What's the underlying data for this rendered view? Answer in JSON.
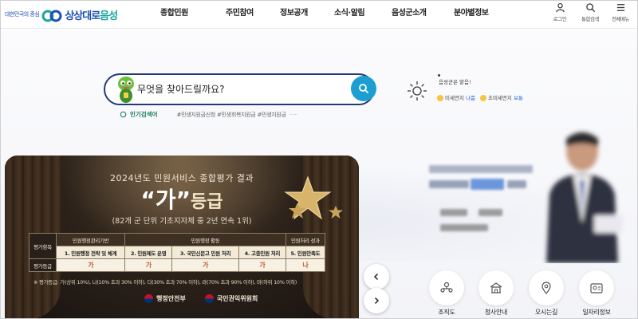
{
  "logo": {
    "tagline": "대한민국의 중심",
    "slogan": "상상대로",
    "city": "음성"
  },
  "nav": {
    "items": [
      {
        "label": "종합민원"
      },
      {
        "label": "주민참여"
      },
      {
        "label": "정보공개"
      },
      {
        "label": "소식·알림"
      },
      {
        "label": "음성군소개"
      },
      {
        "label": "분야별정보"
      }
    ]
  },
  "util": {
    "login": "로그인",
    "search": "통합검색",
    "menu": "전체메뉴"
  },
  "search": {
    "placeholder": "무엇을 찾아드릴까요?",
    "popular_label": "인기검색어",
    "popular_tags": "#민생지원금신청 #민생회복지원금 #민생지원금",
    "more": "·····"
  },
  "weather": {
    "location": "음성군은 맑음!",
    "fine_dust_label": "미세먼지",
    "fine_dust_status": "나쁨",
    "ultra_dust_label": "초미세먼지",
    "ultra_dust_status": "보통",
    "sun_color": "#3a3a3a"
  },
  "banner": {
    "title": "2024년도 민원서비스 종합평가 결과",
    "grade_open": "“",
    "grade_value": "가",
    "grade_close": "”",
    "grade_suffix": "등급",
    "subtitle": "(82개 군 단위 기초지자체 중 2년 연속 1위)",
    "table": {
      "row_label_items": "평가항목",
      "row_label_grade": "평가등급",
      "group1": "민원행정관리기반",
      "group2": "민원행정 활동",
      "group3": "민원처리 성과",
      "items": [
        "1. 민원행정 전략 및 체계",
        "2. 민원제도 운영",
        "3. 국민신문고 민원 처리",
        "4. 고충민원 처리",
        "5. 민원만족도"
      ],
      "grades": [
        "가",
        "가",
        "가",
        "가",
        "나"
      ]
    },
    "note": "※ 평가등급: 가(상위 10%), 나(10% 초과 30% 이하), 다(30% 초과 70% 이하), 라(70% 초과 90% 이하), 마(하위 10% 이하)",
    "org1": "행정안전부",
    "org2": "국민권익위원회"
  },
  "quick_links": [
    {
      "label": "조직도",
      "icon": "org-chart-icon"
    },
    {
      "label": "청사안내",
      "icon": "building-icon"
    },
    {
      "label": "오시는길",
      "icon": "location-pin-icon"
    },
    {
      "label": "일자리정보",
      "icon": "job-info-icon"
    }
  ],
  "colors": {
    "brand_blue": "#1e4fb1",
    "brand_teal": "#1aa5a0",
    "search_border": "#243a78",
    "search_button": "#1d9ed0",
    "grade_text": "#c3572c"
  }
}
